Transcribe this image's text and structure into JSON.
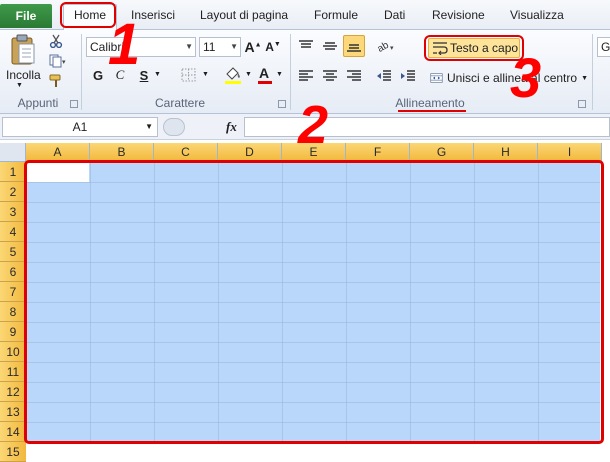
{
  "tabs": {
    "file": "File",
    "items": [
      {
        "label": "Home",
        "active": true
      },
      {
        "label": "Inserisci"
      },
      {
        "label": "Layout di pagina"
      },
      {
        "label": "Formule"
      },
      {
        "label": "Dati"
      },
      {
        "label": "Revisione"
      },
      {
        "label": "Visualizza"
      }
    ]
  },
  "ribbon": {
    "clipboard": {
      "paste_label": "Incolla",
      "group_label": "Appunti"
    },
    "font": {
      "name": "Calibri",
      "size": "11",
      "bold": "G",
      "italic": "C",
      "underline": "S",
      "group_label": "Carattere"
    },
    "alignment": {
      "wrap_text": "Testo a capo",
      "merge_center": "Unisci e allinea al centro",
      "group_label": "Allineamento"
    },
    "number": {
      "format_label": "G"
    }
  },
  "formula_bar": {
    "name_box": "A1",
    "fx": "fx",
    "formula": ""
  },
  "grid": {
    "columns": [
      "A",
      "B",
      "C",
      "D",
      "E",
      "F",
      "G",
      "H",
      "I"
    ],
    "rows": [
      "1",
      "2",
      "3",
      "4",
      "5",
      "6",
      "7",
      "8",
      "9",
      "10",
      "11",
      "12",
      "13",
      "14",
      "15"
    ]
  },
  "annotations": [
    "1",
    "2",
    "3"
  ],
  "colors": {
    "accent_red": "#ff0000",
    "selection": "#b8d7fb",
    "file_tab": "#2b7a35",
    "header_highlight": "#f2b83c"
  }
}
